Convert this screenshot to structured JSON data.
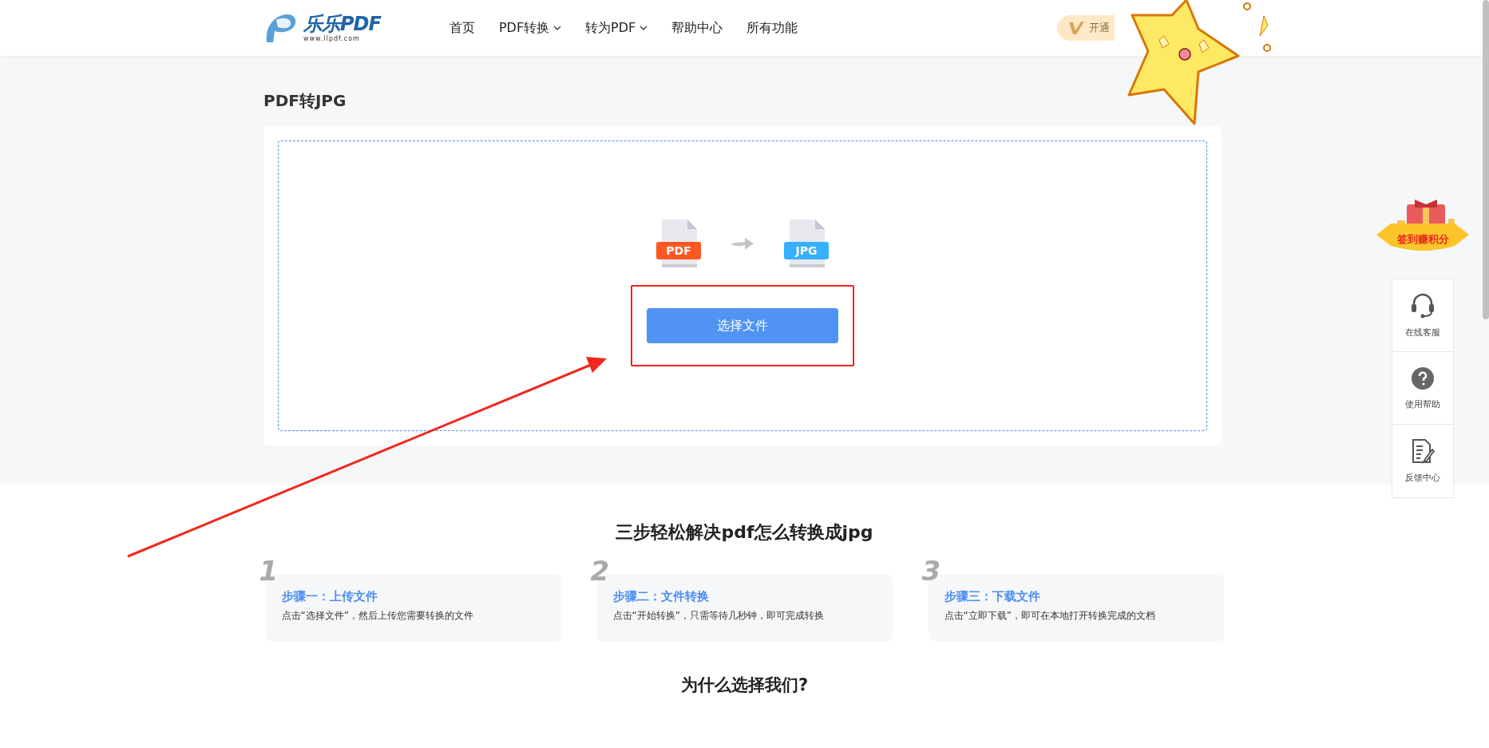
{
  "header": {
    "logo": {
      "name": "乐乐PDF",
      "url": "www.llpdf.com"
    },
    "nav": [
      {
        "label": "首页",
        "dropdown": false
      },
      {
        "label": "PDF转换",
        "dropdown": true
      },
      {
        "label": "转为PDF",
        "dropdown": true
      },
      {
        "label": "帮助中心",
        "dropdown": false
      },
      {
        "label": "所有功能",
        "dropdown": false
      }
    ],
    "vip_button": "开通"
  },
  "page_title": "PDF转JPG",
  "upload": {
    "from_format": "PDF",
    "to_format": "JPG",
    "button": "选择文件"
  },
  "steps_section": {
    "title": "三步轻松解决pdf怎么转换成jpg",
    "steps": [
      {
        "number": "1",
        "title": "步骤一：上传文件",
        "text": "点击“选择文件”，然后上传您需要转换的文件"
      },
      {
        "number": "2",
        "title": "步骤二：文件转换",
        "text": "点击“开始转换”，只需等待几秒钟，即可完成转换"
      },
      {
        "number": "3",
        "title": "步骤三：下载文件",
        "text": "点击“立即下载”，即可在本地打开转换完成的文档"
      }
    ]
  },
  "why_section": {
    "title": "为什么选择我们?"
  },
  "sign_in_badge": "签到赚积分",
  "side_tools": [
    {
      "kind": "headset",
      "label": "在线客服"
    },
    {
      "kind": "help",
      "label": "使用帮助"
    },
    {
      "kind": "feedback",
      "label": "反馈中心"
    }
  ]
}
